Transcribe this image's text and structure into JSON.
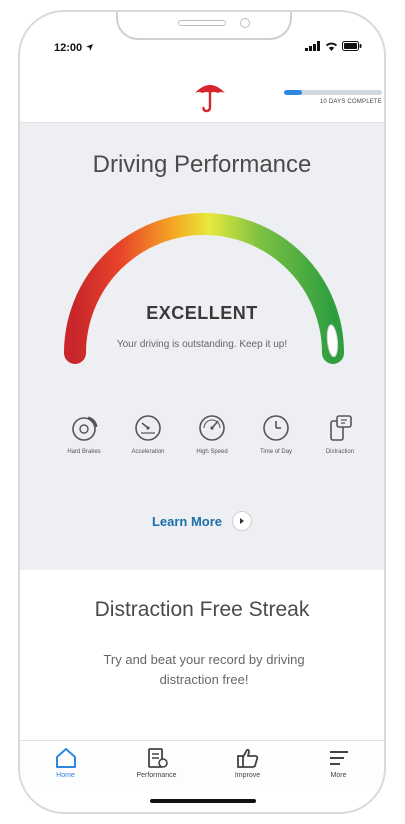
{
  "status_bar": {
    "time": "12:00",
    "icons": [
      "location-arrow-icon",
      "signal-icon",
      "wifi-icon",
      "battery-icon"
    ]
  },
  "header": {
    "logo_icon": "red-umbrella-icon",
    "progress": {
      "label": "10 DAYS COMPLETE",
      "fraction": 0.18
    }
  },
  "performance": {
    "title": "Driving Performance",
    "rating": "EXCELLENT",
    "message": "Your driving is outstanding. Keep it up!",
    "score_fraction": 0.97,
    "gauge_colors": [
      "#c8262a",
      "#e8452a",
      "#f6a623",
      "#e7e93c",
      "#7bc143",
      "#2e9e3f"
    ],
    "metrics": [
      {
        "label": "Hard Brakes",
        "icon": "brake-disc-icon"
      },
      {
        "label": "Acceleration",
        "icon": "speedometer-icon"
      },
      {
        "label": "High Speed",
        "icon": "gauge-icon"
      },
      {
        "label": "Time of Day",
        "icon": "clock-icon"
      },
      {
        "label": "Distraction",
        "icon": "phone-distraction-icon"
      }
    ],
    "learn_more": "Learn More"
  },
  "streak": {
    "title": "Distraction Free Streak",
    "subtitle": "Try and beat your record by driving distraction free!"
  },
  "tabs": [
    {
      "label": "Home",
      "icon": "home-icon",
      "active": true
    },
    {
      "label": "Performance",
      "icon": "performance-icon",
      "active": false
    },
    {
      "label": "Improve",
      "icon": "thumbs-up-icon",
      "active": false
    },
    {
      "label": "More",
      "icon": "menu-icon",
      "active": false
    }
  ],
  "colors": {
    "accent": "#2f87e1",
    "link": "#1d6fa8",
    "brand_red": "#d7262e"
  }
}
